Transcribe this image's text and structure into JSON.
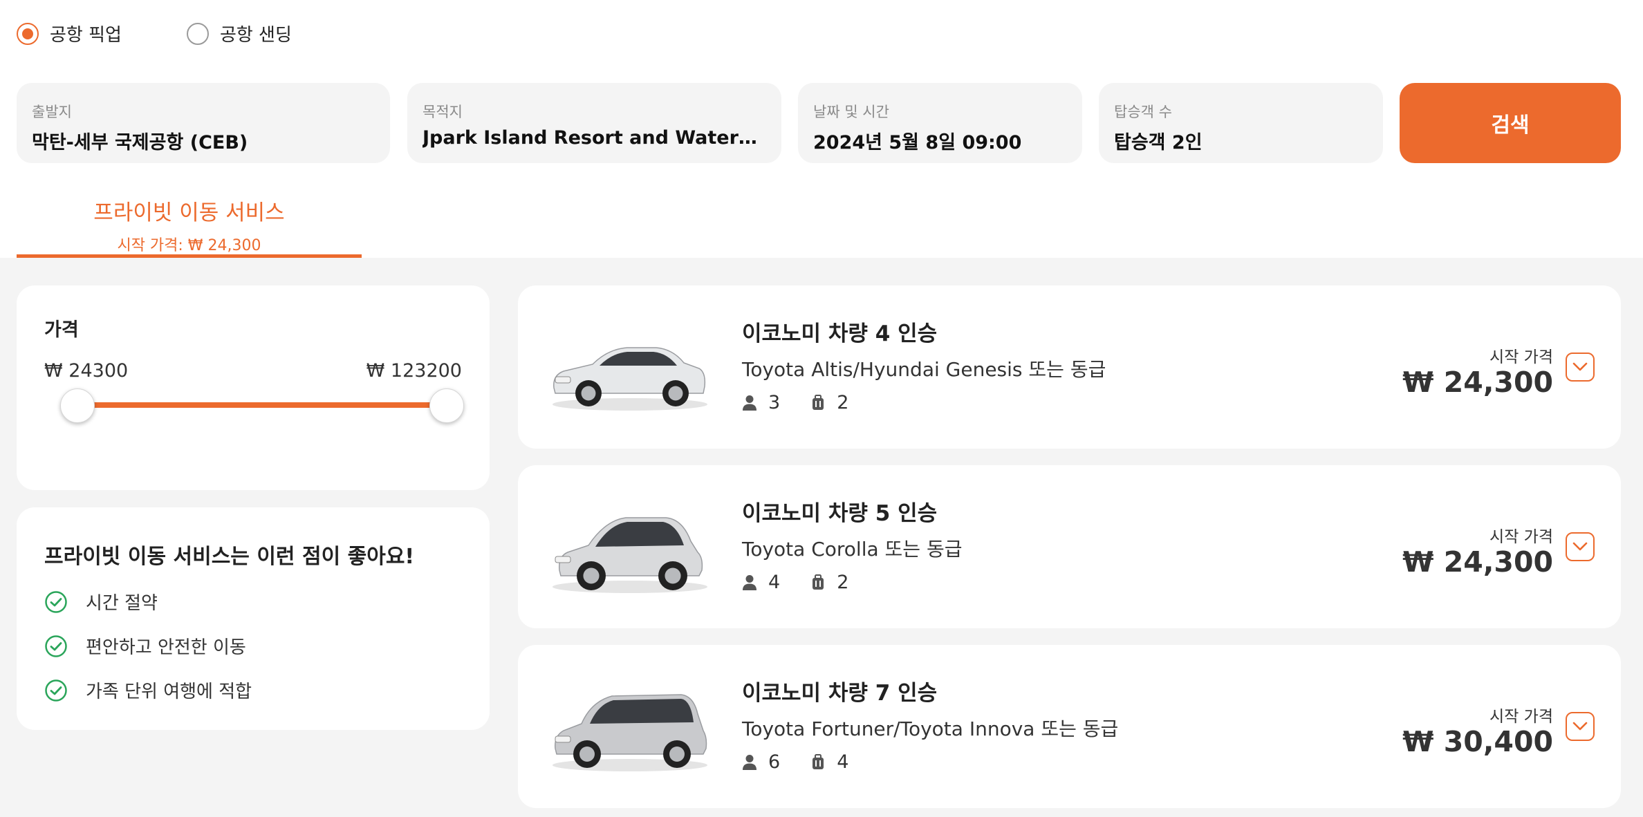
{
  "trip_type": {
    "options": [
      {
        "label": "공항 픽업",
        "selected": true
      },
      {
        "label": "공항 샌딩",
        "selected": false
      }
    ]
  },
  "search": {
    "origin": {
      "label": "출발지",
      "value": "막탄-세부 국제공항 (CEB)"
    },
    "destination": {
      "label": "목적지",
      "value": "Jpark Island Resort and Waterpark Cebu"
    },
    "datetime": {
      "label": "날짜 및 시간",
      "value": "2024년 5월 8일 09:00"
    },
    "passengers": {
      "label": "탑승객 수",
      "value": "탑승객 2인"
    },
    "button_label": "검색"
  },
  "tab": {
    "name": "프라이빗 이동 서비스",
    "price": "시작 가격: ₩ 24,300"
  },
  "price_filter": {
    "title": "가격",
    "min_label": "₩ 24300",
    "max_label": "₩ 123200",
    "range_min": 24300,
    "range_max": 123200,
    "selected_min": 24300,
    "selected_max": 123200
  },
  "benefits": {
    "title": "프라이빗 이동 서비스는 이런 점이 좋아요!",
    "items": [
      "시간 절약",
      "편안하고 안전한 이동",
      "가족 단위 여행에 적합"
    ]
  },
  "cars": [
    {
      "name": "이코노미 차량 4 인승",
      "models": "Toyota Altis/Hyundai Genesis 또는 동급",
      "passengers": "3",
      "luggage": "2",
      "start_label": "시작 가격",
      "price": "₩ 24,300",
      "body": "sedan",
      "color": "#e6e8ea"
    },
    {
      "name": "이코노미 차량 5 인승",
      "models": "Toyota Corolla 또는 동급",
      "passengers": "4",
      "luggage": "2",
      "start_label": "시작 가격",
      "price": "₩ 24,300",
      "body": "hatchback",
      "color": "#d9dadc"
    },
    {
      "name": "이코노미 차량 7 인승",
      "models": "Toyota Fortuner/Toyota Innova 또는 동급",
      "passengers": "6",
      "luggage": "4",
      "start_label": "시작 가격",
      "price": "₩ 30,400",
      "body": "mpv",
      "color": "#c9cacd"
    }
  ],
  "colors": {
    "accent": "#ec6a2d",
    "check": "#2aa55a",
    "background": "#f4f4f4"
  }
}
